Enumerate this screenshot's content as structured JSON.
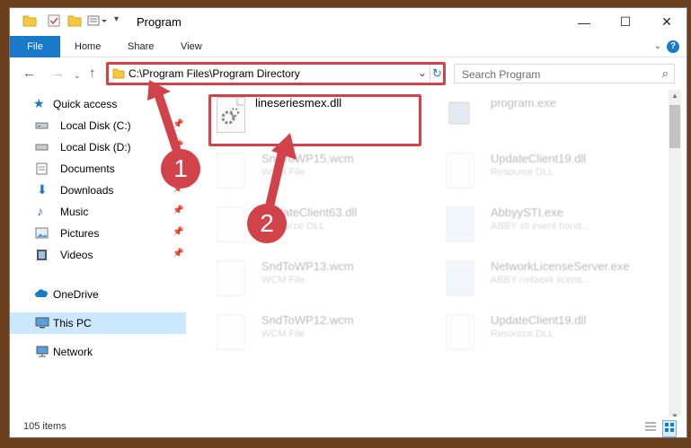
{
  "window": {
    "title": "Program",
    "minimize_glyph": "—",
    "maximize_glyph": "☐",
    "close_glyph": "✕"
  },
  "ribbon": {
    "tabs": [
      "File",
      "Home",
      "Share",
      "View"
    ],
    "help": "?"
  },
  "nav": {
    "address": "C:\\Program Files\\Program Directory",
    "search_placeholder": "Search Program"
  },
  "sidebar": {
    "items": [
      {
        "label": "Quick access",
        "icon": "star-icon"
      },
      {
        "label": "Local Disk (C:)",
        "icon": "drive-icon",
        "pinned": true
      },
      {
        "label": "Local Disk (D:)",
        "icon": "drive-icon",
        "pinned": true
      },
      {
        "label": "Documents",
        "icon": "documents-icon",
        "pinned": true
      },
      {
        "label": "Downloads",
        "icon": "download-icon",
        "pinned": true
      },
      {
        "label": "Music",
        "icon": "music-icon",
        "pinned": true
      },
      {
        "label": "Pictures",
        "icon": "pictures-icon",
        "pinned": true
      },
      {
        "label": "Videos",
        "icon": "videos-icon",
        "pinned": true
      },
      {
        "label": "OneDrive",
        "icon": "cloud-icon"
      },
      {
        "label": "This PC",
        "icon": "computer-icon",
        "selected": true
      },
      {
        "label": "Network",
        "icon": "network-icon"
      }
    ]
  },
  "files": [
    {
      "name": "lineseriesmex.dll",
      "sub": ""
    },
    {
      "name": "program.exe",
      "sub": ""
    },
    {
      "name": "SndToWP15.wcm",
      "sub": "WCM File"
    },
    {
      "name": "UpdateClient19.dll",
      "sub": "Resource DLL"
    },
    {
      "name": "UpdateClient63.dll",
      "sub": "Resource DLL"
    },
    {
      "name": "AbbyySTI.exe",
      "sub": "ABBY sti event hand..."
    },
    {
      "name": "SndToWP13.wcm",
      "sub": "WCM File"
    },
    {
      "name": "NetworkLicenseServer.exe",
      "sub": "ABBY network licens..."
    },
    {
      "name": "SndToWP12.wcm",
      "sub": "WCM File"
    },
    {
      "name": "UpdateClient19.dll",
      "sub": "Resource DLL"
    }
  ],
  "status": {
    "count": "105 items"
  },
  "callouts": [
    "1",
    "2"
  ],
  "colors": {
    "accent": "#1979ca",
    "highlight": "#d2424a"
  }
}
